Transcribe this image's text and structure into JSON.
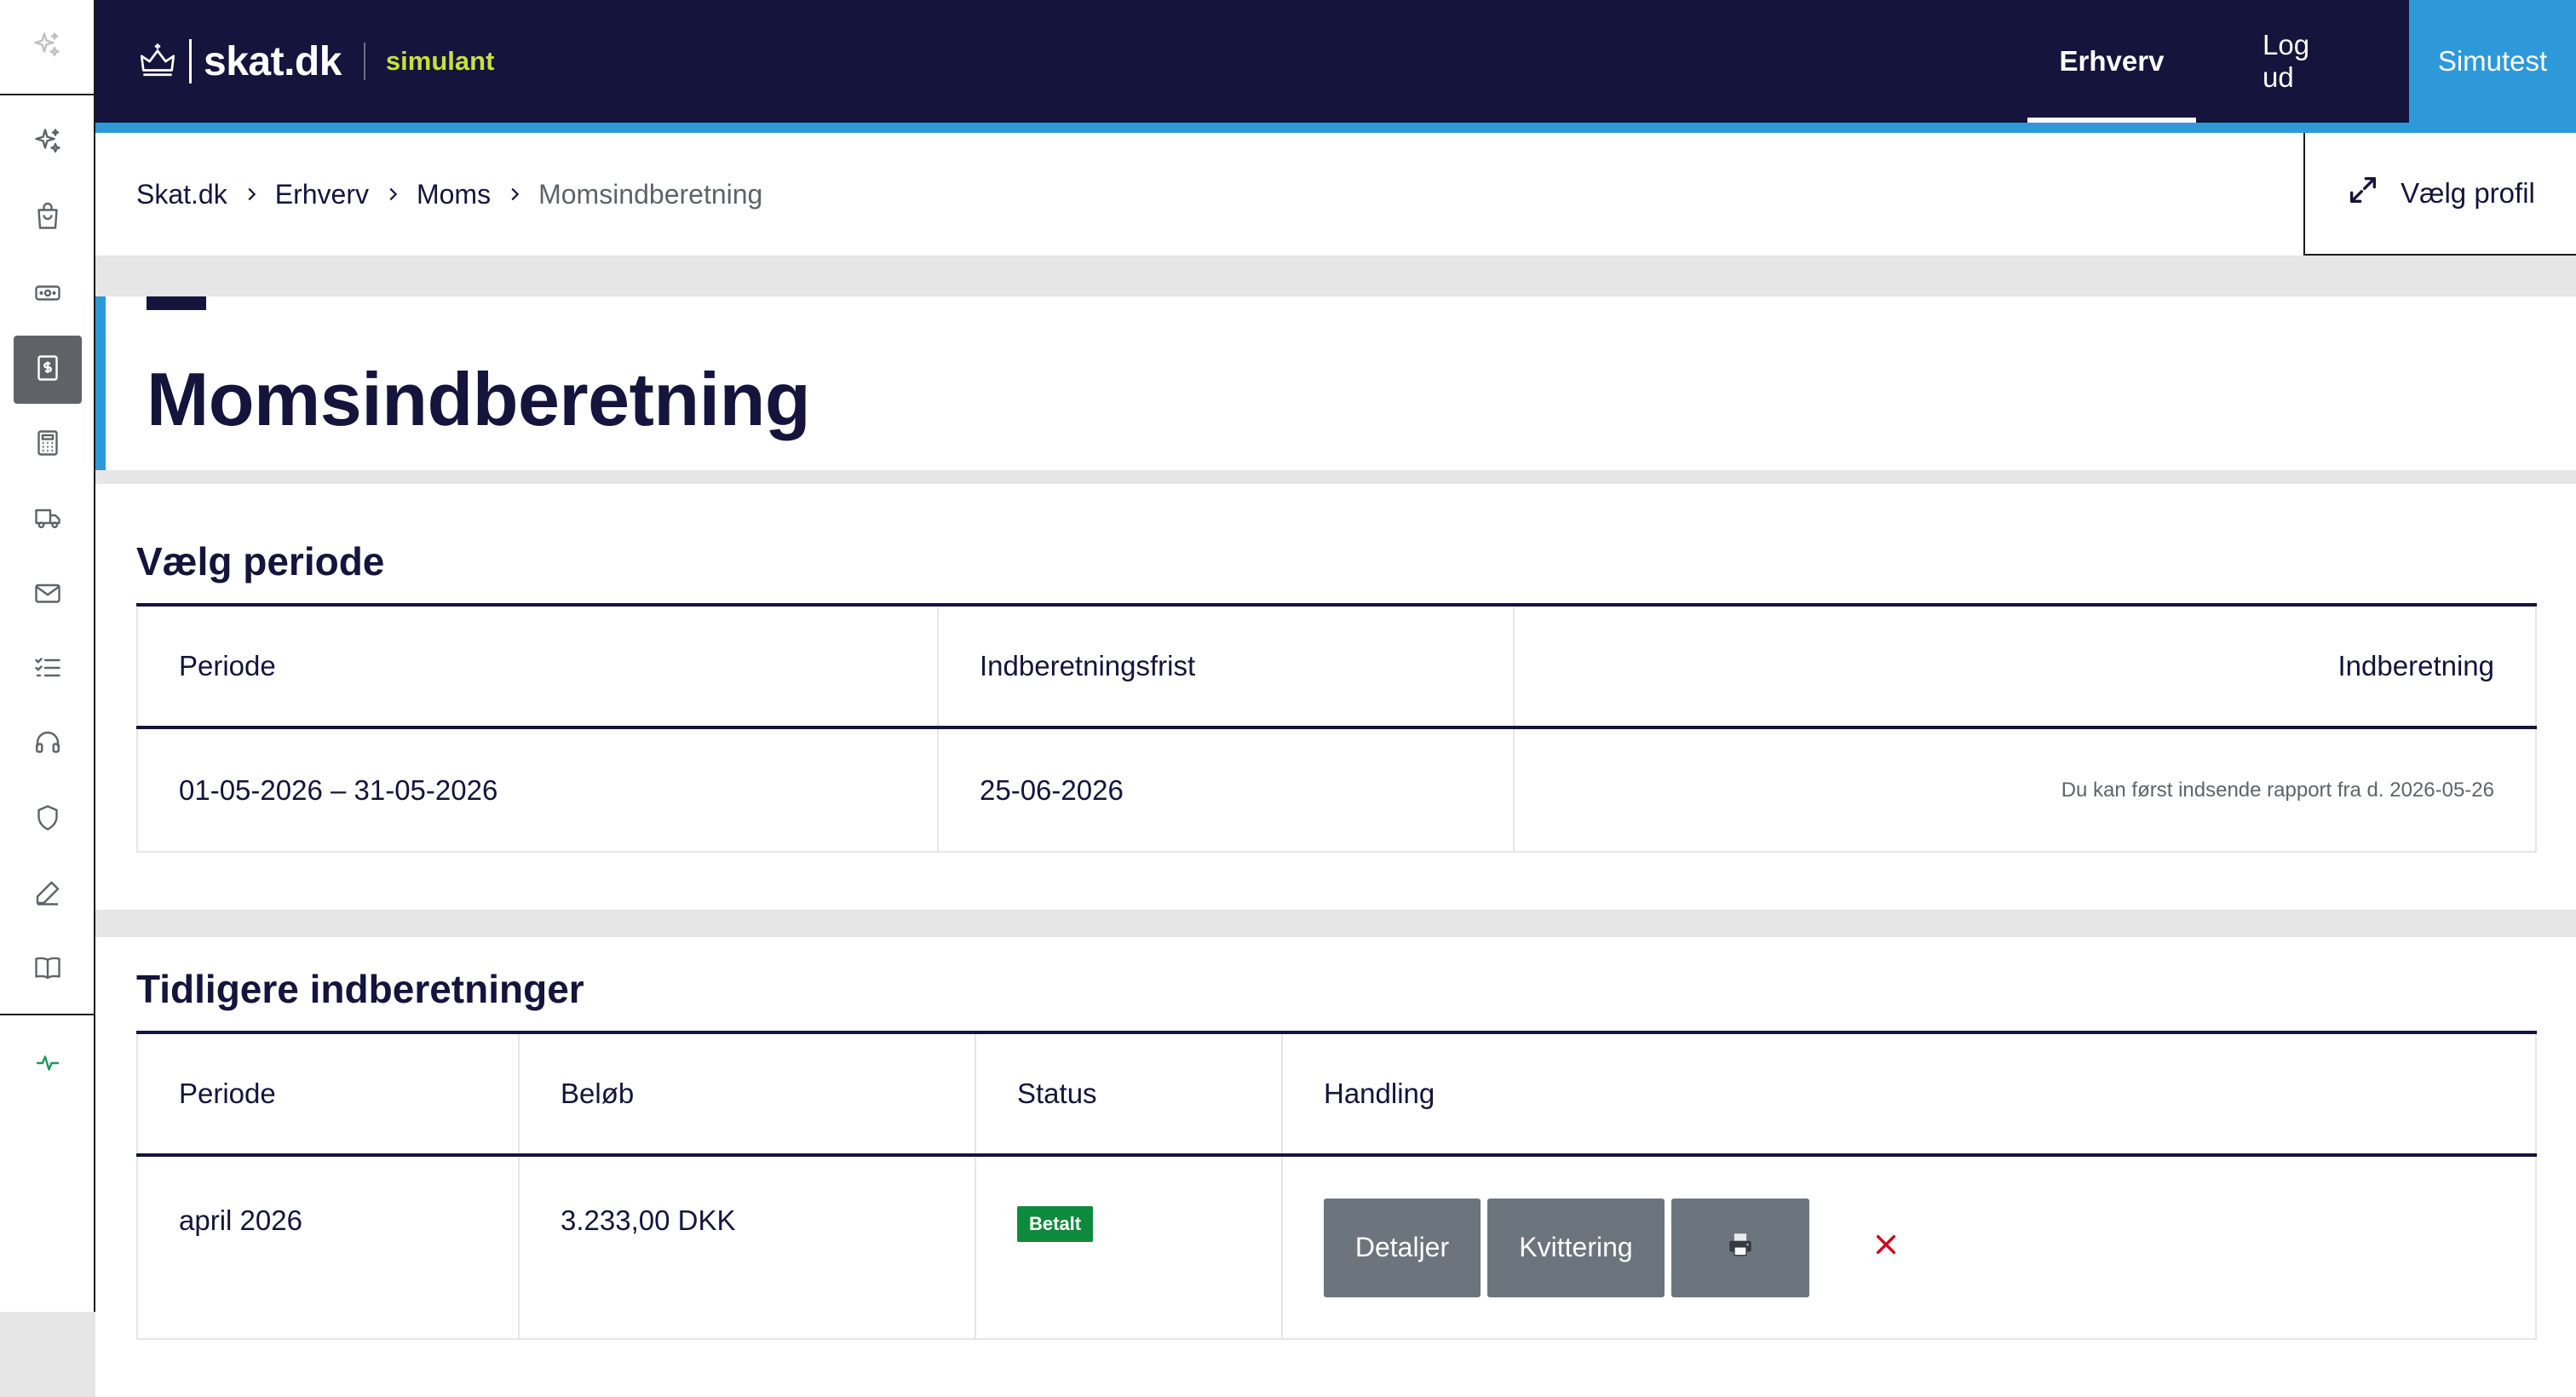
{
  "header": {
    "brand": "skat.dk",
    "subbrand": "simulant",
    "nav": [
      {
        "label": "Erhverv",
        "active": true
      },
      {
        "label": "Log ud",
        "active": false
      },
      {
        "label": "Simutest",
        "active": false
      }
    ]
  },
  "sidebar": {
    "top_icon": "sparkle-icon",
    "items": [
      {
        "icon": "sparkle-icon",
        "active": false
      },
      {
        "icon": "shopping-bag-icon",
        "active": false
      },
      {
        "icon": "banknote-icon",
        "active": false
      },
      {
        "icon": "dollar-document-icon",
        "active": true
      },
      {
        "icon": "calculator-icon",
        "active": false
      },
      {
        "icon": "truck-icon",
        "active": false
      },
      {
        "icon": "mail-icon",
        "active": false
      },
      {
        "icon": "checklist-icon",
        "active": false
      },
      {
        "icon": "headset-icon",
        "active": false
      },
      {
        "icon": "shield-icon",
        "active": false
      },
      {
        "icon": "pen-icon",
        "active": false
      },
      {
        "icon": "book-icon",
        "active": false
      }
    ],
    "bottom_icon": "activity-icon"
  },
  "breadcrumb": [
    "Skat.dk",
    "Erhverv",
    "Moms",
    "Momsindberetning"
  ],
  "profile_button": "Vælg profil",
  "page_title": "Momsindberetning",
  "period_section": {
    "title": "Vælg periode",
    "columns": [
      "Periode",
      "Indberetningsfrist",
      "Indberetning"
    ],
    "row": {
      "period": "01-05-2026 – 31-05-2026",
      "deadline": "25-06-2026",
      "note": "Du kan først indsende rapport fra d. 2026-05-26"
    }
  },
  "previous_section": {
    "title": "Tidligere indberetninger",
    "columns": [
      "Periode",
      "Beløb",
      "Status",
      "Handling"
    ],
    "row": {
      "period": "april 2026",
      "amount": "3.233,00 DKK",
      "status": "Betalt",
      "actions": {
        "details": "Detaljer",
        "receipt": "Kvittering",
        "print_icon": "printer-icon",
        "delete_icon": "close-icon"
      }
    }
  },
  "colors": {
    "navy": "#14143c",
    "accent_blue": "#2e99d9",
    "lime": "#c8e03c",
    "status_green": "#0f8a3c",
    "button_gray": "#6c757d",
    "delete_red": "#d0021b"
  }
}
